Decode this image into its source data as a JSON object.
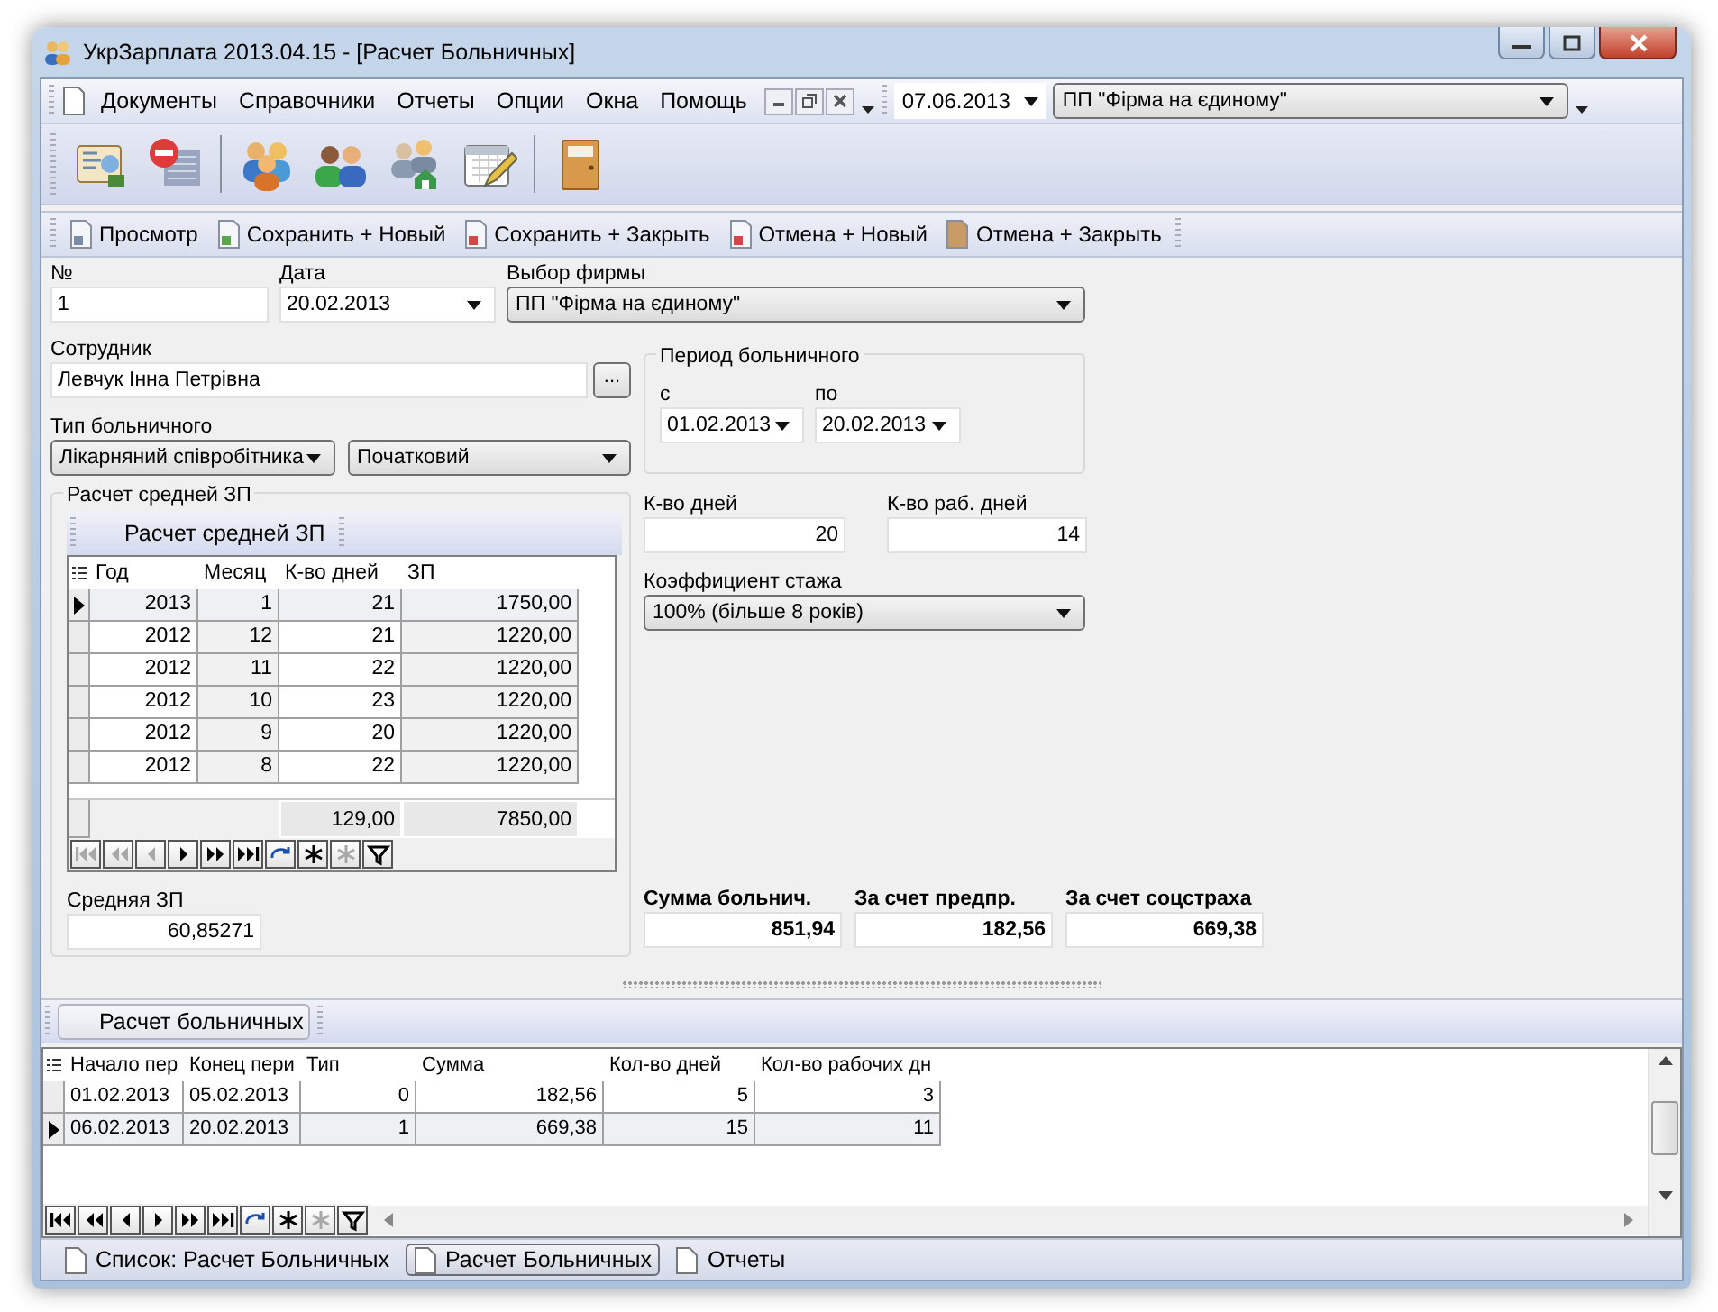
{
  "window": {
    "title": "УкрЗарплата 2013.04.15 - [Расчет Больничных]"
  },
  "menu": [
    "Документы",
    "Справочники",
    "Отчеты",
    "Опции",
    "Окна",
    "Помощь"
  ],
  "menu_date": "07.06.2013",
  "menu_firm": "ПП \"Фірма на єдиному\"",
  "actions": [
    {
      "label": "Просмотр",
      "kind": "view"
    },
    {
      "label": "Сохранить + Новый",
      "kind": "save_new"
    },
    {
      "label": "Сохранить + Закрыть",
      "kind": "save_close"
    },
    {
      "label": "Отмена + Новый",
      "kind": "cancel_new"
    },
    {
      "label": "Отмена + Закрыть",
      "kind": "cancel_close"
    }
  ],
  "form": {
    "number": {
      "label": "№",
      "value": "1"
    },
    "date": {
      "label": "Дата",
      "value": "20.02.2013"
    },
    "firm": {
      "label": "Выбор фирмы",
      "value": "ПП \"Фірма на єдиному\""
    },
    "employee": {
      "label": "Сотрудник",
      "value": "Левчук Інна Петрівна",
      "button": "..."
    },
    "sick_type": {
      "label": "Тип больничного",
      "values": [
        "Лікарняний співробітника",
        "Початковий"
      ]
    },
    "period": {
      "title": "Период больничного",
      "from_label": "с",
      "from": "01.02.2013",
      "to_label": "по",
      "to": "20.02.2013"
    },
    "days": {
      "label": "К-во дней",
      "value": "20"
    },
    "work_days": {
      "label": "К-во раб. дней",
      "value": "14"
    },
    "coefficient": {
      "label": "Коэффициент стажа",
      "value": "100% (більше 8 років)"
    },
    "average": {
      "title": "Расчет средней ЗП",
      "toolbar_button": "Расчет средней ЗП",
      "columns": [
        "Год",
        "Месяц",
        "К-во дней",
        "ЗП"
      ],
      "rows": [
        {
          "cells": [
            "2013",
            "1",
            "21",
            "1750,00"
          ],
          "selected": true
        },
        {
          "cells": [
            "2012",
            "12",
            "21",
            "1220,00"
          ],
          "selected": false
        },
        {
          "cells": [
            "2012",
            "11",
            "22",
            "1220,00"
          ],
          "selected": false
        },
        {
          "cells": [
            "2012",
            "10",
            "23",
            "1220,00"
          ],
          "selected": false
        },
        {
          "cells": [
            "2012",
            "9",
            "20",
            "1220,00"
          ],
          "selected": false
        },
        {
          "cells": [
            "2012",
            "8",
            "22",
            "1220,00"
          ],
          "selected": false
        }
      ],
      "totals": {
        "days": "129,00",
        "salary": "7850,00"
      },
      "navigator": [
        {
          "kind": "first",
          "disabled": true
        },
        {
          "kind": "prior_page",
          "disabled": true
        },
        {
          "kind": "prior",
          "disabled": true
        },
        {
          "kind": "next",
          "disabled": false
        },
        {
          "kind": "next_page",
          "disabled": false
        },
        {
          "kind": "last",
          "disabled": false
        },
        {
          "kind": "refresh",
          "disabled": false
        },
        {
          "kind": "insert",
          "disabled": false
        },
        {
          "kind": "delete",
          "disabled": true
        },
        {
          "kind": "filter",
          "disabled": false
        }
      ]
    },
    "average_salary": {
      "label": "Средняя ЗП",
      "value": "60,85271"
    },
    "sums": [
      {
        "label": "Сумма больнич.",
        "value": "851,94"
      },
      {
        "label": "За счет предпр.",
        "value": "182,56"
      },
      {
        "label": "За счет соцстраха",
        "value": "669,38"
      }
    ]
  },
  "detail": {
    "toolbar_button": "Расчет больничных",
    "columns": [
      "Начало пер",
      "Конец пери",
      "Тип",
      "Сумма",
      "Кол-во дней",
      "Кол-во рабочих дн"
    ],
    "rows": [
      {
        "cells": [
          "01.02.2013",
          "05.02.2013",
          "0",
          "182,56",
          "5",
          "3"
        ],
        "selected": false
      },
      {
        "cells": [
          "06.02.2013",
          "20.02.2013",
          "1",
          "669,38",
          "15",
          "11"
        ],
        "selected": true
      }
    ],
    "navigator": [
      {
        "kind": "first",
        "disabled": false
      },
      {
        "kind": "prior_page",
        "disabled": false
      },
      {
        "kind": "prior",
        "disabled": false
      },
      {
        "kind": "next",
        "disabled": false
      },
      {
        "kind": "next_page",
        "disabled": false
      },
      {
        "kind": "last",
        "disabled": false
      },
      {
        "kind": "refresh",
        "disabled": false
      },
      {
        "kind": "insert",
        "disabled": false
      },
      {
        "kind": "delete",
        "disabled": true
      },
      {
        "kind": "filter",
        "disabled": false
      }
    ]
  },
  "tabs": [
    {
      "label": "Список: Расчет Больничных",
      "selected": false
    },
    {
      "label": "Расчет Больничных",
      "selected": true
    },
    {
      "label": "Отчеты",
      "selected": false
    }
  ]
}
